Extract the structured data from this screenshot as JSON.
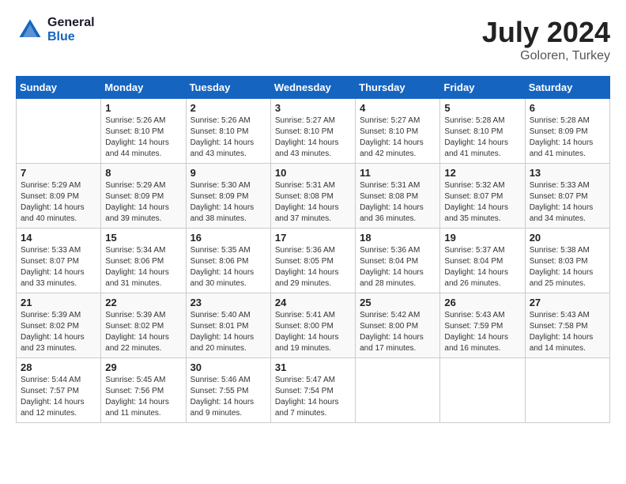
{
  "header": {
    "logo_line1": "General",
    "logo_line2": "Blue",
    "month": "July 2024",
    "location": "Goloren, Turkey"
  },
  "weekdays": [
    "Sunday",
    "Monday",
    "Tuesday",
    "Wednesday",
    "Thursday",
    "Friday",
    "Saturday"
  ],
  "weeks": [
    [
      {
        "day": "",
        "sunrise": "",
        "sunset": "",
        "daylight": ""
      },
      {
        "day": "1",
        "sunrise": "5:26 AM",
        "sunset": "8:10 PM",
        "daylight": "14 hours and 44 minutes."
      },
      {
        "day": "2",
        "sunrise": "5:26 AM",
        "sunset": "8:10 PM",
        "daylight": "14 hours and 43 minutes."
      },
      {
        "day": "3",
        "sunrise": "5:27 AM",
        "sunset": "8:10 PM",
        "daylight": "14 hours and 43 minutes."
      },
      {
        "day": "4",
        "sunrise": "5:27 AM",
        "sunset": "8:10 PM",
        "daylight": "14 hours and 42 minutes."
      },
      {
        "day": "5",
        "sunrise": "5:28 AM",
        "sunset": "8:10 PM",
        "daylight": "14 hours and 41 minutes."
      },
      {
        "day": "6",
        "sunrise": "5:28 AM",
        "sunset": "8:09 PM",
        "daylight": "14 hours and 41 minutes."
      }
    ],
    [
      {
        "day": "7",
        "sunrise": "5:29 AM",
        "sunset": "8:09 PM",
        "daylight": "14 hours and 40 minutes."
      },
      {
        "day": "8",
        "sunrise": "5:29 AM",
        "sunset": "8:09 PM",
        "daylight": "14 hours and 39 minutes."
      },
      {
        "day": "9",
        "sunrise": "5:30 AM",
        "sunset": "8:09 PM",
        "daylight": "14 hours and 38 minutes."
      },
      {
        "day": "10",
        "sunrise": "5:31 AM",
        "sunset": "8:08 PM",
        "daylight": "14 hours and 37 minutes."
      },
      {
        "day": "11",
        "sunrise": "5:31 AM",
        "sunset": "8:08 PM",
        "daylight": "14 hours and 36 minutes."
      },
      {
        "day": "12",
        "sunrise": "5:32 AM",
        "sunset": "8:07 PM",
        "daylight": "14 hours and 35 minutes."
      },
      {
        "day": "13",
        "sunrise": "5:33 AM",
        "sunset": "8:07 PM",
        "daylight": "14 hours and 34 minutes."
      }
    ],
    [
      {
        "day": "14",
        "sunrise": "5:33 AM",
        "sunset": "8:07 PM",
        "daylight": "14 hours and 33 minutes."
      },
      {
        "day": "15",
        "sunrise": "5:34 AM",
        "sunset": "8:06 PM",
        "daylight": "14 hours and 31 minutes."
      },
      {
        "day": "16",
        "sunrise": "5:35 AM",
        "sunset": "8:06 PM",
        "daylight": "14 hours and 30 minutes."
      },
      {
        "day": "17",
        "sunrise": "5:36 AM",
        "sunset": "8:05 PM",
        "daylight": "14 hours and 29 minutes."
      },
      {
        "day": "18",
        "sunrise": "5:36 AM",
        "sunset": "8:04 PM",
        "daylight": "14 hours and 28 minutes."
      },
      {
        "day": "19",
        "sunrise": "5:37 AM",
        "sunset": "8:04 PM",
        "daylight": "14 hours and 26 minutes."
      },
      {
        "day": "20",
        "sunrise": "5:38 AM",
        "sunset": "8:03 PM",
        "daylight": "14 hours and 25 minutes."
      }
    ],
    [
      {
        "day": "21",
        "sunrise": "5:39 AM",
        "sunset": "8:02 PM",
        "daylight": "14 hours and 23 minutes."
      },
      {
        "day": "22",
        "sunrise": "5:39 AM",
        "sunset": "8:02 PM",
        "daylight": "14 hours and 22 minutes."
      },
      {
        "day": "23",
        "sunrise": "5:40 AM",
        "sunset": "8:01 PM",
        "daylight": "14 hours and 20 minutes."
      },
      {
        "day": "24",
        "sunrise": "5:41 AM",
        "sunset": "8:00 PM",
        "daylight": "14 hours and 19 minutes."
      },
      {
        "day": "25",
        "sunrise": "5:42 AM",
        "sunset": "8:00 PM",
        "daylight": "14 hours and 17 minutes."
      },
      {
        "day": "26",
        "sunrise": "5:43 AM",
        "sunset": "7:59 PM",
        "daylight": "14 hours and 16 minutes."
      },
      {
        "day": "27",
        "sunrise": "5:43 AM",
        "sunset": "7:58 PM",
        "daylight": "14 hours and 14 minutes."
      }
    ],
    [
      {
        "day": "28",
        "sunrise": "5:44 AM",
        "sunset": "7:57 PM",
        "daylight": "14 hours and 12 minutes."
      },
      {
        "day": "29",
        "sunrise": "5:45 AM",
        "sunset": "7:56 PM",
        "daylight": "14 hours and 11 minutes."
      },
      {
        "day": "30",
        "sunrise": "5:46 AM",
        "sunset": "7:55 PM",
        "daylight": "14 hours and 9 minutes."
      },
      {
        "day": "31",
        "sunrise": "5:47 AM",
        "sunset": "7:54 PM",
        "daylight": "14 hours and 7 minutes."
      },
      {
        "day": "",
        "sunrise": "",
        "sunset": "",
        "daylight": ""
      },
      {
        "day": "",
        "sunrise": "",
        "sunset": "",
        "daylight": ""
      },
      {
        "day": "",
        "sunrise": "",
        "sunset": "",
        "daylight": ""
      }
    ]
  ]
}
